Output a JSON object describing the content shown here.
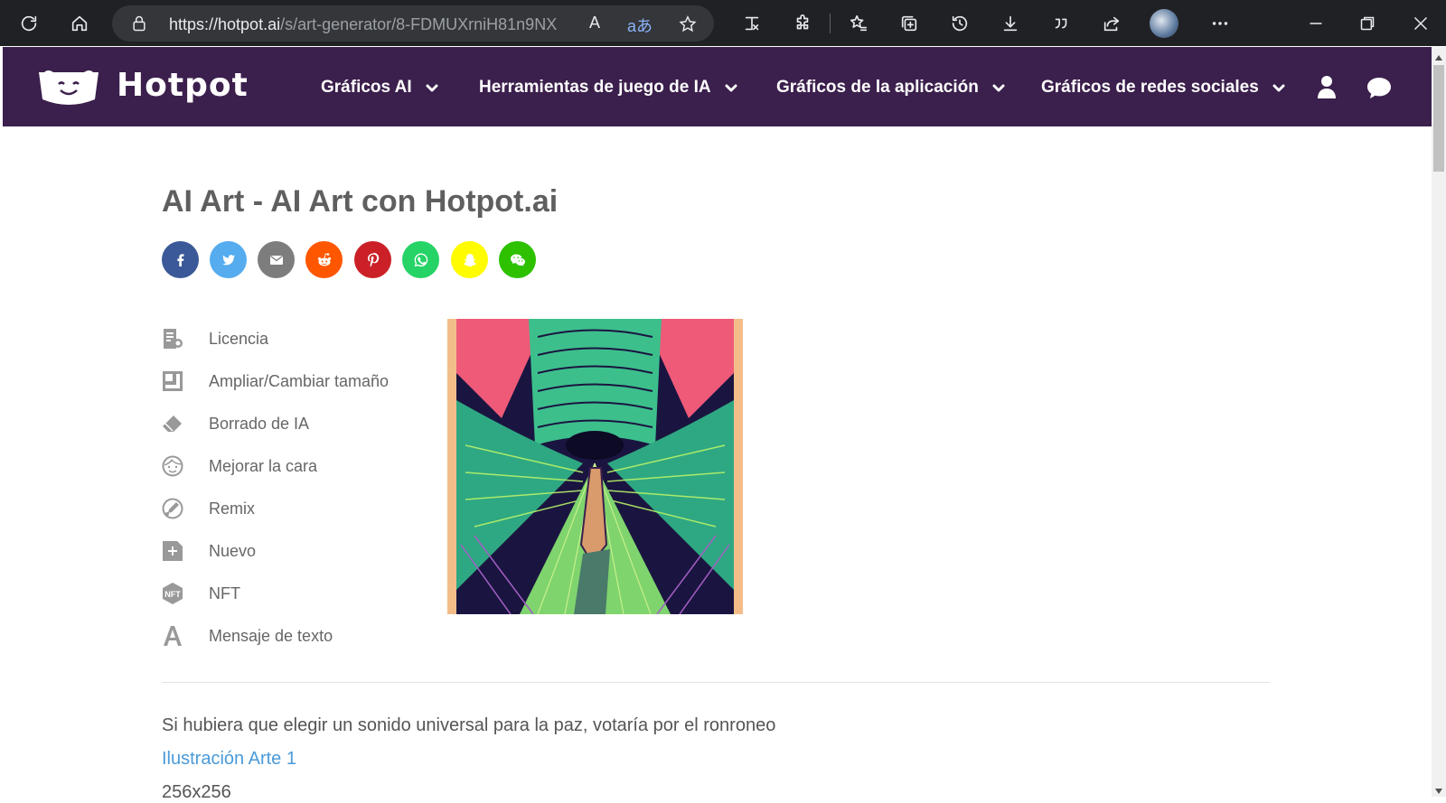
{
  "browser": {
    "url_host": "https://hotpot.ai",
    "url_path": "/s/art-generator/8-FDMUXrniH81n9NX",
    "read_aloud": "A",
    "translate": "aあ",
    "icons": [
      "refresh-icon",
      "home-icon",
      "lock-icon",
      "read-aloud-icon",
      "translate-icon",
      "add-favorite-icon",
      "math-solver-icon",
      "extensions-icon",
      "favorites-icon",
      "collections-icon",
      "history-icon",
      "downloads-icon",
      "quote-icon",
      "share-icon",
      "profile-avatar",
      "more-icon",
      "minimize-icon",
      "restore-icon",
      "close-icon"
    ]
  },
  "header": {
    "brand": "Hotpot",
    "nav": [
      {
        "label": "Gráficos AI"
      },
      {
        "label": "Herramientas de juego de IA"
      },
      {
        "label": "Gráficos de la aplicación"
      },
      {
        "label": "Gráficos de redes sociales"
      }
    ],
    "bg_color": "#3b1f4c"
  },
  "main": {
    "title": "AI Art - AI Art con Hotpot.ai",
    "share": [
      {
        "name": "facebook",
        "color": "#3b5998"
      },
      {
        "name": "twitter",
        "color": "#55acee"
      },
      {
        "name": "email",
        "color": "#7d7d7d"
      },
      {
        "name": "reddit",
        "color": "#ff5700"
      },
      {
        "name": "pinterest",
        "color": "#cb2027"
      },
      {
        "name": "whatsapp",
        "color": "#25d366"
      },
      {
        "name": "snapchat",
        "color": "#fffc00"
      },
      {
        "name": "wechat",
        "color": "#2dc100"
      }
    ],
    "tools": [
      {
        "label": "Licencia",
        "icon": "license-icon"
      },
      {
        "label": "Ampliar/Cambiar tamaño",
        "icon": "resize-icon"
      },
      {
        "label": "Borrado de IA",
        "icon": "eraser-icon"
      },
      {
        "label": "Mejorar la cara",
        "icon": "face-icon"
      },
      {
        "label": "Remix",
        "icon": "remix-icon"
      },
      {
        "label": "Nuevo",
        "icon": "new-icon"
      },
      {
        "label": "NFT",
        "icon": "nft-icon"
      },
      {
        "label": "Mensaje de texto",
        "icon": "text-icon"
      }
    ],
    "prompt": "Si hubiera que elegir un sonido universal para la paz, votaría por el ronroneo",
    "link": "Ilustración Arte 1",
    "size": "256x256"
  }
}
